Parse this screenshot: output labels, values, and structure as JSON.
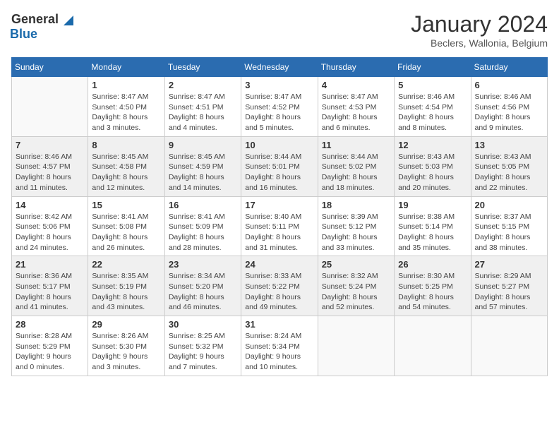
{
  "header": {
    "logo_general": "General",
    "logo_blue": "Blue",
    "title": "January 2024",
    "subtitle": "Beclers, Wallonia, Belgium"
  },
  "calendar": {
    "weekdays": [
      "Sunday",
      "Monday",
      "Tuesday",
      "Wednesday",
      "Thursday",
      "Friday",
      "Saturday"
    ],
    "rows": [
      [
        {
          "day": "",
          "sunrise": "",
          "sunset": "",
          "daylight": "",
          "empty": true
        },
        {
          "day": "1",
          "sunrise": "Sunrise: 8:47 AM",
          "sunset": "Sunset: 4:50 PM",
          "daylight": "Daylight: 8 hours and 3 minutes.",
          "empty": false
        },
        {
          "day": "2",
          "sunrise": "Sunrise: 8:47 AM",
          "sunset": "Sunset: 4:51 PM",
          "daylight": "Daylight: 8 hours and 4 minutes.",
          "empty": false
        },
        {
          "day": "3",
          "sunrise": "Sunrise: 8:47 AM",
          "sunset": "Sunset: 4:52 PM",
          "daylight": "Daylight: 8 hours and 5 minutes.",
          "empty": false
        },
        {
          "day": "4",
          "sunrise": "Sunrise: 8:47 AM",
          "sunset": "Sunset: 4:53 PM",
          "daylight": "Daylight: 8 hours and 6 minutes.",
          "empty": false
        },
        {
          "day": "5",
          "sunrise": "Sunrise: 8:46 AM",
          "sunset": "Sunset: 4:54 PM",
          "daylight": "Daylight: 8 hours and 8 minutes.",
          "empty": false
        },
        {
          "day": "6",
          "sunrise": "Sunrise: 8:46 AM",
          "sunset": "Sunset: 4:56 PM",
          "daylight": "Daylight: 8 hours and 9 minutes.",
          "empty": false
        }
      ],
      [
        {
          "day": "7",
          "sunrise": "Sunrise: 8:46 AM",
          "sunset": "Sunset: 4:57 PM",
          "daylight": "Daylight: 8 hours and 11 minutes.",
          "empty": false
        },
        {
          "day": "8",
          "sunrise": "Sunrise: 8:45 AM",
          "sunset": "Sunset: 4:58 PM",
          "daylight": "Daylight: 8 hours and 12 minutes.",
          "empty": false
        },
        {
          "day": "9",
          "sunrise": "Sunrise: 8:45 AM",
          "sunset": "Sunset: 4:59 PM",
          "daylight": "Daylight: 8 hours and 14 minutes.",
          "empty": false
        },
        {
          "day": "10",
          "sunrise": "Sunrise: 8:44 AM",
          "sunset": "Sunset: 5:01 PM",
          "daylight": "Daylight: 8 hours and 16 minutes.",
          "empty": false
        },
        {
          "day": "11",
          "sunrise": "Sunrise: 8:44 AM",
          "sunset": "Sunset: 5:02 PM",
          "daylight": "Daylight: 8 hours and 18 minutes.",
          "empty": false
        },
        {
          "day": "12",
          "sunrise": "Sunrise: 8:43 AM",
          "sunset": "Sunset: 5:03 PM",
          "daylight": "Daylight: 8 hours and 20 minutes.",
          "empty": false
        },
        {
          "day": "13",
          "sunrise": "Sunrise: 8:43 AM",
          "sunset": "Sunset: 5:05 PM",
          "daylight": "Daylight: 8 hours and 22 minutes.",
          "empty": false
        }
      ],
      [
        {
          "day": "14",
          "sunrise": "Sunrise: 8:42 AM",
          "sunset": "Sunset: 5:06 PM",
          "daylight": "Daylight: 8 hours and 24 minutes.",
          "empty": false
        },
        {
          "day": "15",
          "sunrise": "Sunrise: 8:41 AM",
          "sunset": "Sunset: 5:08 PM",
          "daylight": "Daylight: 8 hours and 26 minutes.",
          "empty": false
        },
        {
          "day": "16",
          "sunrise": "Sunrise: 8:41 AM",
          "sunset": "Sunset: 5:09 PM",
          "daylight": "Daylight: 8 hours and 28 minutes.",
          "empty": false
        },
        {
          "day": "17",
          "sunrise": "Sunrise: 8:40 AM",
          "sunset": "Sunset: 5:11 PM",
          "daylight": "Daylight: 8 hours and 31 minutes.",
          "empty": false
        },
        {
          "day": "18",
          "sunrise": "Sunrise: 8:39 AM",
          "sunset": "Sunset: 5:12 PM",
          "daylight": "Daylight: 8 hours and 33 minutes.",
          "empty": false
        },
        {
          "day": "19",
          "sunrise": "Sunrise: 8:38 AM",
          "sunset": "Sunset: 5:14 PM",
          "daylight": "Daylight: 8 hours and 35 minutes.",
          "empty": false
        },
        {
          "day": "20",
          "sunrise": "Sunrise: 8:37 AM",
          "sunset": "Sunset: 5:15 PM",
          "daylight": "Daylight: 8 hours and 38 minutes.",
          "empty": false
        }
      ],
      [
        {
          "day": "21",
          "sunrise": "Sunrise: 8:36 AM",
          "sunset": "Sunset: 5:17 PM",
          "daylight": "Daylight: 8 hours and 41 minutes.",
          "empty": false
        },
        {
          "day": "22",
          "sunrise": "Sunrise: 8:35 AM",
          "sunset": "Sunset: 5:19 PM",
          "daylight": "Daylight: 8 hours and 43 minutes.",
          "empty": false
        },
        {
          "day": "23",
          "sunrise": "Sunrise: 8:34 AM",
          "sunset": "Sunset: 5:20 PM",
          "daylight": "Daylight: 8 hours and 46 minutes.",
          "empty": false
        },
        {
          "day": "24",
          "sunrise": "Sunrise: 8:33 AM",
          "sunset": "Sunset: 5:22 PM",
          "daylight": "Daylight: 8 hours and 49 minutes.",
          "empty": false
        },
        {
          "day": "25",
          "sunrise": "Sunrise: 8:32 AM",
          "sunset": "Sunset: 5:24 PM",
          "daylight": "Daylight: 8 hours and 52 minutes.",
          "empty": false
        },
        {
          "day": "26",
          "sunrise": "Sunrise: 8:30 AM",
          "sunset": "Sunset: 5:25 PM",
          "daylight": "Daylight: 8 hours and 54 minutes.",
          "empty": false
        },
        {
          "day": "27",
          "sunrise": "Sunrise: 8:29 AM",
          "sunset": "Sunset: 5:27 PM",
          "daylight": "Daylight: 8 hours and 57 minutes.",
          "empty": false
        }
      ],
      [
        {
          "day": "28",
          "sunrise": "Sunrise: 8:28 AM",
          "sunset": "Sunset: 5:29 PM",
          "daylight": "Daylight: 9 hours and 0 minutes.",
          "empty": false
        },
        {
          "day": "29",
          "sunrise": "Sunrise: 8:26 AM",
          "sunset": "Sunset: 5:30 PM",
          "daylight": "Daylight: 9 hours and 3 minutes.",
          "empty": false
        },
        {
          "day": "30",
          "sunrise": "Sunrise: 8:25 AM",
          "sunset": "Sunset: 5:32 PM",
          "daylight": "Daylight: 9 hours and 7 minutes.",
          "empty": false
        },
        {
          "day": "31",
          "sunrise": "Sunrise: 8:24 AM",
          "sunset": "Sunset: 5:34 PM",
          "daylight": "Daylight: 9 hours and 10 minutes.",
          "empty": false
        },
        {
          "day": "",
          "sunrise": "",
          "sunset": "",
          "daylight": "",
          "empty": true
        },
        {
          "day": "",
          "sunrise": "",
          "sunset": "",
          "daylight": "",
          "empty": true
        },
        {
          "day": "",
          "sunrise": "",
          "sunset": "",
          "daylight": "",
          "empty": true
        }
      ]
    ]
  }
}
